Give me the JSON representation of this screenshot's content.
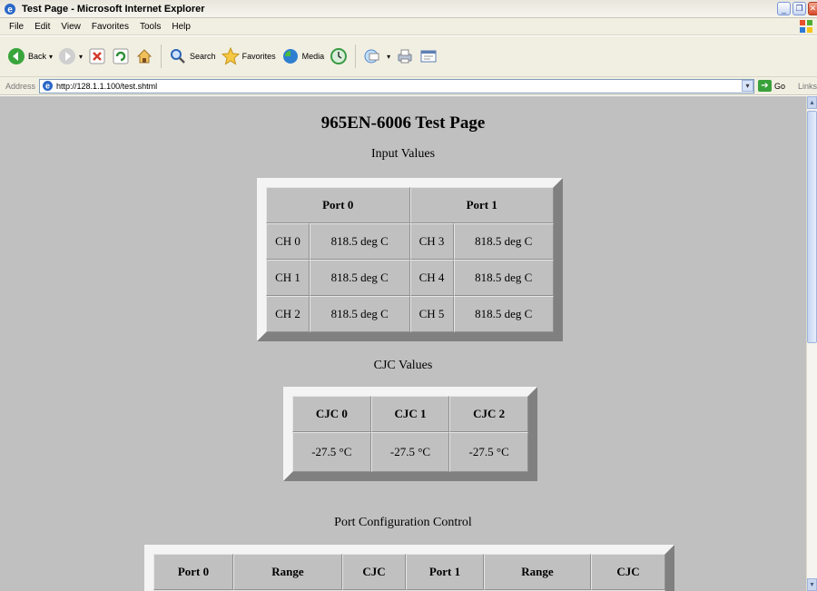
{
  "window": {
    "title": "Test Page - Microsoft Internet Explorer"
  },
  "menu": [
    "File",
    "Edit",
    "View",
    "Favorites",
    "Tools",
    "Help"
  ],
  "toolbar": {
    "back_label": "Back",
    "search_label": "Search",
    "favorites_label": "Favorites",
    "media_label": "Media"
  },
  "address": {
    "label": "Address",
    "url": "http://128.1.1.100/test.shtml",
    "go_label": "Go",
    "links_label": "Links"
  },
  "page": {
    "title": "965EN-6006 Test Page",
    "input_section": "Input Values",
    "input_table": {
      "headers": [
        "Port 0",
        "Port 1"
      ],
      "rows": [
        [
          "CH 0",
          "818.5 deg C",
          "CH 3",
          "818.5 deg C"
        ],
        [
          "CH 1",
          "818.5 deg C",
          "CH 4",
          "818.5 deg C"
        ],
        [
          "CH 2",
          "818.5 deg C",
          "CH 5",
          "818.5 deg C"
        ]
      ]
    },
    "cjc_section": "CJC Values",
    "cjc_table": {
      "headers": [
        "CJC 0",
        "CJC 1",
        "CJC 2"
      ],
      "values": [
        "-27.5 °C",
        "-27.5 °C",
        "-27.5 °C"
      ]
    },
    "port_section": "Port Configuration Control",
    "port_table": {
      "headers": [
        "Port 0",
        "Range",
        "CJC",
        "Port 1",
        "Range",
        "CJC"
      ]
    }
  }
}
